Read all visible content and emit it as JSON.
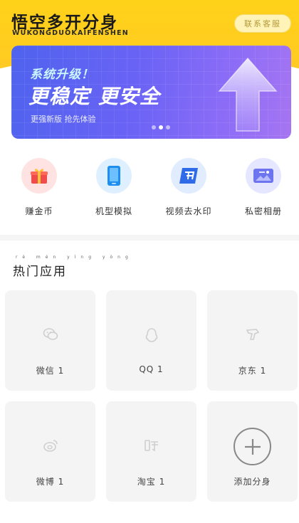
{
  "header": {
    "title": "悟空多开分身",
    "subtitle": "WUKONGDUOKAIFENSHEN",
    "contact_label": "联系客服"
  },
  "banner": {
    "tag": "系统升级！",
    "title": "更稳定 更安全",
    "subtitle": "更强新版 抢先体验",
    "slide_count": 3,
    "active_slide": 2
  },
  "features": [
    {
      "label": "赚金币",
      "icon": "gift-icon",
      "color": "#f24b4b"
    },
    {
      "label": "机型模拟",
      "icon": "phone-icon",
      "color": "#1e8ff0"
    },
    {
      "label": "视频去水印",
      "icon": "video-icon",
      "color": "#2f6be8"
    },
    {
      "label": "私密相册",
      "icon": "album-icon",
      "color": "#6d74f0"
    }
  ],
  "section": {
    "title": "热门应用",
    "pinyin": "rè mén yìng yòng"
  },
  "apps": [
    {
      "name": "微信 1",
      "icon": "wechat-icon"
    },
    {
      "name": "QQ 1",
      "icon": "qq-icon"
    },
    {
      "name": "京东 1",
      "icon": "jd-icon"
    },
    {
      "name": "微博 1",
      "icon": "weibo-icon"
    },
    {
      "name": "淘宝 1",
      "icon": "taobao-icon"
    },
    {
      "name": "添加分身",
      "icon": "plus-icon"
    }
  ],
  "colors": {
    "brand_yellow": "#ffd21a",
    "banner_start": "#4f63ee",
    "banner_end": "#a675f2",
    "card_bg": "#f4f4f4"
  }
}
